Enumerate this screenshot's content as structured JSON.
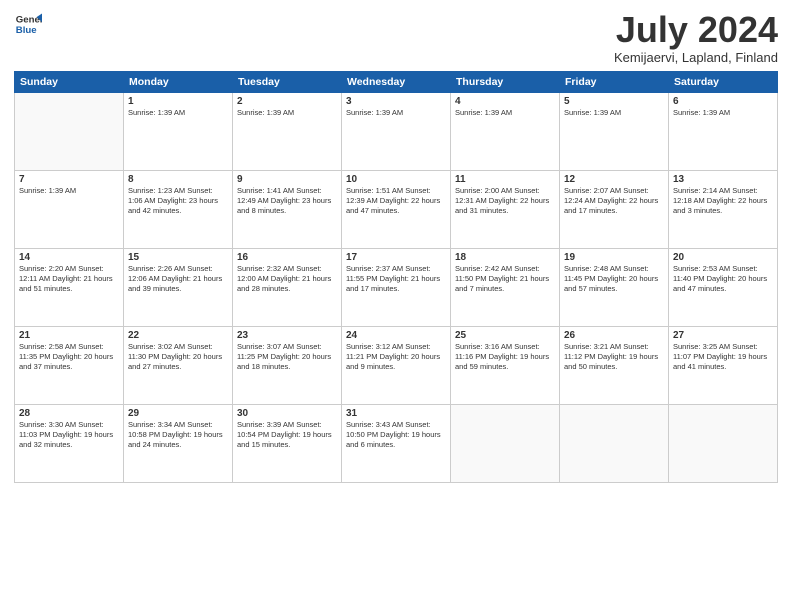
{
  "logo": {
    "line1": "General",
    "line2": "Blue"
  },
  "title": "July 2024",
  "subtitle": "Kemijaervi, Lapland, Finland",
  "weekdays": [
    "Sunday",
    "Monday",
    "Tuesday",
    "Wednesday",
    "Thursday",
    "Friday",
    "Saturday"
  ],
  "weeks": [
    [
      {
        "day": "",
        "info": ""
      },
      {
        "day": "1",
        "info": "Sunrise: 1:39 AM"
      },
      {
        "day": "2",
        "info": "Sunrise: 1:39 AM"
      },
      {
        "day": "3",
        "info": "Sunrise: 1:39 AM"
      },
      {
        "day": "4",
        "info": "Sunrise: 1:39 AM"
      },
      {
        "day": "5",
        "info": "Sunrise: 1:39 AM"
      },
      {
        "day": "6",
        "info": "Sunrise: 1:39 AM"
      }
    ],
    [
      {
        "day": "7",
        "info": "Sunrise: 1:39 AM"
      },
      {
        "day": "8",
        "info": "Sunrise: 1:23 AM\nSunset: 1:06 AM\nDaylight: 23 hours and 42 minutes."
      },
      {
        "day": "9",
        "info": "Sunrise: 1:41 AM\nSunset: 12:49 AM\nDaylight: 23 hours and 8 minutes."
      },
      {
        "day": "10",
        "info": "Sunrise: 1:51 AM\nSunset: 12:39 AM\nDaylight: 22 hours and 47 minutes."
      },
      {
        "day": "11",
        "info": "Sunrise: 2:00 AM\nSunset: 12:31 AM\nDaylight: 22 hours and 31 minutes."
      },
      {
        "day": "12",
        "info": "Sunrise: 2:07 AM\nSunset: 12:24 AM\nDaylight: 22 hours and 17 minutes."
      },
      {
        "day": "13",
        "info": "Sunrise: 2:14 AM\nSunset: 12:18 AM\nDaylight: 22 hours and 3 minutes."
      }
    ],
    [
      {
        "day": "14",
        "info": "Sunrise: 2:20 AM\nSunset: 12:11 AM\nDaylight: 21 hours and 51 minutes."
      },
      {
        "day": "15",
        "info": "Sunrise: 2:26 AM\nSunset: 12:06 AM\nDaylight: 21 hours and 39 minutes."
      },
      {
        "day": "16",
        "info": "Sunrise: 2:32 AM\nSunset: 12:00 AM\nDaylight: 21 hours and 28 minutes."
      },
      {
        "day": "17",
        "info": "Sunrise: 2:37 AM\nSunset: 11:55 PM\nDaylight: 21 hours and 17 minutes."
      },
      {
        "day": "18",
        "info": "Sunrise: 2:42 AM\nSunset: 11:50 PM\nDaylight: 21 hours and 7 minutes."
      },
      {
        "day": "19",
        "info": "Sunrise: 2:48 AM\nSunset: 11:45 PM\nDaylight: 20 hours and 57 minutes."
      },
      {
        "day": "20",
        "info": "Sunrise: 2:53 AM\nSunset: 11:40 PM\nDaylight: 20 hours and 47 minutes."
      }
    ],
    [
      {
        "day": "21",
        "info": "Sunrise: 2:58 AM\nSunset: 11:35 PM\nDaylight: 20 hours and 37 minutes."
      },
      {
        "day": "22",
        "info": "Sunrise: 3:02 AM\nSunset: 11:30 PM\nDaylight: 20 hours and 27 minutes."
      },
      {
        "day": "23",
        "info": "Sunrise: 3:07 AM\nSunset: 11:25 PM\nDaylight: 20 hours and 18 minutes."
      },
      {
        "day": "24",
        "info": "Sunrise: 3:12 AM\nSunset: 11:21 PM\nDaylight: 20 hours and 9 minutes."
      },
      {
        "day": "25",
        "info": "Sunrise: 3:16 AM\nSunset: 11:16 PM\nDaylight: 19 hours and 59 minutes."
      },
      {
        "day": "26",
        "info": "Sunrise: 3:21 AM\nSunset: 11:12 PM\nDaylight: 19 hours and 50 minutes."
      },
      {
        "day": "27",
        "info": "Sunrise: 3:25 AM\nSunset: 11:07 PM\nDaylight: 19 hours and 41 minutes."
      }
    ],
    [
      {
        "day": "28",
        "info": "Sunrise: 3:30 AM\nSunset: 11:03 PM\nDaylight: 19 hours and 32 minutes."
      },
      {
        "day": "29",
        "info": "Sunrise: 3:34 AM\nSunset: 10:58 PM\nDaylight: 19 hours and 24 minutes."
      },
      {
        "day": "30",
        "info": "Sunrise: 3:39 AM\nSunset: 10:54 PM\nDaylight: 19 hours and 15 minutes."
      },
      {
        "day": "31",
        "info": "Sunrise: 3:43 AM\nSunset: 10:50 PM\nDaylight: 19 hours and 6 minutes."
      },
      {
        "day": "",
        "info": ""
      },
      {
        "day": "",
        "info": ""
      },
      {
        "day": "",
        "info": ""
      }
    ]
  ]
}
